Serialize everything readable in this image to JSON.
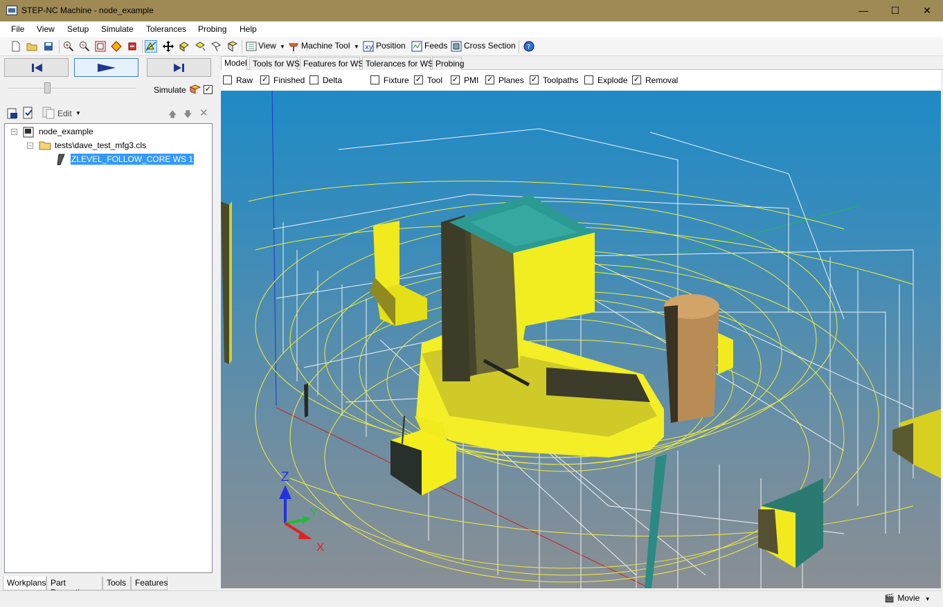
{
  "window": {
    "title": "STEP-NC Machine - node_example",
    "min": "—",
    "max": "☐",
    "close": "✕"
  },
  "menu": [
    "File",
    "View",
    "Setup",
    "Simulate",
    "Tolerances",
    "Probing",
    "Help"
  ],
  "toolbar": {
    "view_label": "View",
    "machine_tool_label": "Machine Tool",
    "position_label": "Position",
    "feeds_label": "Feeds",
    "cross_section_label": "Cross Section"
  },
  "simulate": {
    "label": "Simulate",
    "checked": true
  },
  "tree_toolbar": {
    "edit_label": "Edit"
  },
  "tree": {
    "root": "node_example",
    "child": "tests\\dave_test_mfg3.cls",
    "leaf": "ZLEVEL_FOLLOW_CORE WS 1"
  },
  "left_tabs": [
    "Workplans",
    "Part Properties",
    "Tools",
    "Features"
  ],
  "view_tabs": [
    "Model",
    "Tools for WS",
    "Features for WS",
    "Tolerances for WS",
    "Probing"
  ],
  "display_options": [
    {
      "label": "Raw",
      "checked": false
    },
    {
      "label": "Finished",
      "checked": true
    },
    {
      "label": "Delta",
      "checked": false
    },
    {
      "label": "Fixture",
      "checked": false
    },
    {
      "label": "Tool",
      "checked": true
    },
    {
      "label": "PMI",
      "checked": true
    },
    {
      "label": "Planes",
      "checked": true
    },
    {
      "label": "Toolpaths",
      "checked": true
    },
    {
      "label": "Explode",
      "checked": false
    },
    {
      "label": "Removal",
      "checked": true
    }
  ],
  "axes": {
    "x": "X",
    "y": "Y",
    "z": "Z"
  },
  "status": {
    "movie_label": "Movie"
  },
  "colors": {
    "titlebar": "#9f8a56",
    "selection": "#3399ff",
    "toolpath": "#f5f532",
    "part": "#f0ea1e"
  }
}
